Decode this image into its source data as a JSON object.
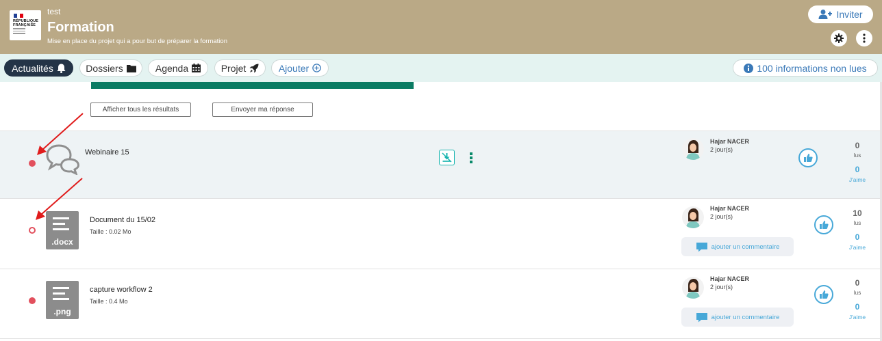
{
  "header": {
    "logo_text": [
      "RÉPUBLIQUE",
      "FRANÇAISE"
    ],
    "project_sup": "test",
    "project_title": "Formation",
    "project_desc": "Mise en place du projet qui a pour but de préparer la formation",
    "invite_label": "Inviter",
    "colors": {
      "background": "#baa986",
      "accent": "#3a79b8"
    }
  },
  "nav": {
    "tabs": [
      {
        "label": "Actualités",
        "icon": "bell-icon"
      },
      {
        "label": "Dossiers",
        "icon": "folder-icon"
      },
      {
        "label": "Agenda",
        "icon": "calendar-icon"
      },
      {
        "label": "Projet",
        "icon": "rocket-icon"
      },
      {
        "label": "Ajouter",
        "icon": "plus-circle-icon"
      }
    ],
    "unread": "100 informations non lues"
  },
  "poll": {
    "show_results": "Afficher tous les résultats",
    "send_answer": "Envoyer ma réponse",
    "bar_color": "#0a7b63"
  },
  "feed": [
    {
      "title": "Webinaire 15",
      "type": "discussion",
      "unread": true,
      "author": "Hajar NACER",
      "when": "2 jour(s)",
      "reads": "0",
      "reads_label": "lus",
      "likes": "0",
      "likes_label": "J'aime"
    },
    {
      "title": "Document du 15/02",
      "size": "Taille : 0.02 Mo",
      "ext": ".docx",
      "unread": false,
      "author": "Hajar NACER",
      "when": "2 jour(s)",
      "comment": "ajouter un commentaire",
      "reads": "10",
      "reads_label": "lus",
      "likes": "0",
      "likes_label": "J'aime"
    },
    {
      "title": "capture workflow 2",
      "size": "Taille : 0.4 Mo",
      "ext": ".png",
      "unread": true,
      "author": "Hajar NACER",
      "when": "2 jour(s)",
      "comment": "ajouter un commentaire",
      "reads": "0",
      "reads_label": "lus",
      "likes": "0",
      "likes_label": "J'aime"
    }
  ]
}
